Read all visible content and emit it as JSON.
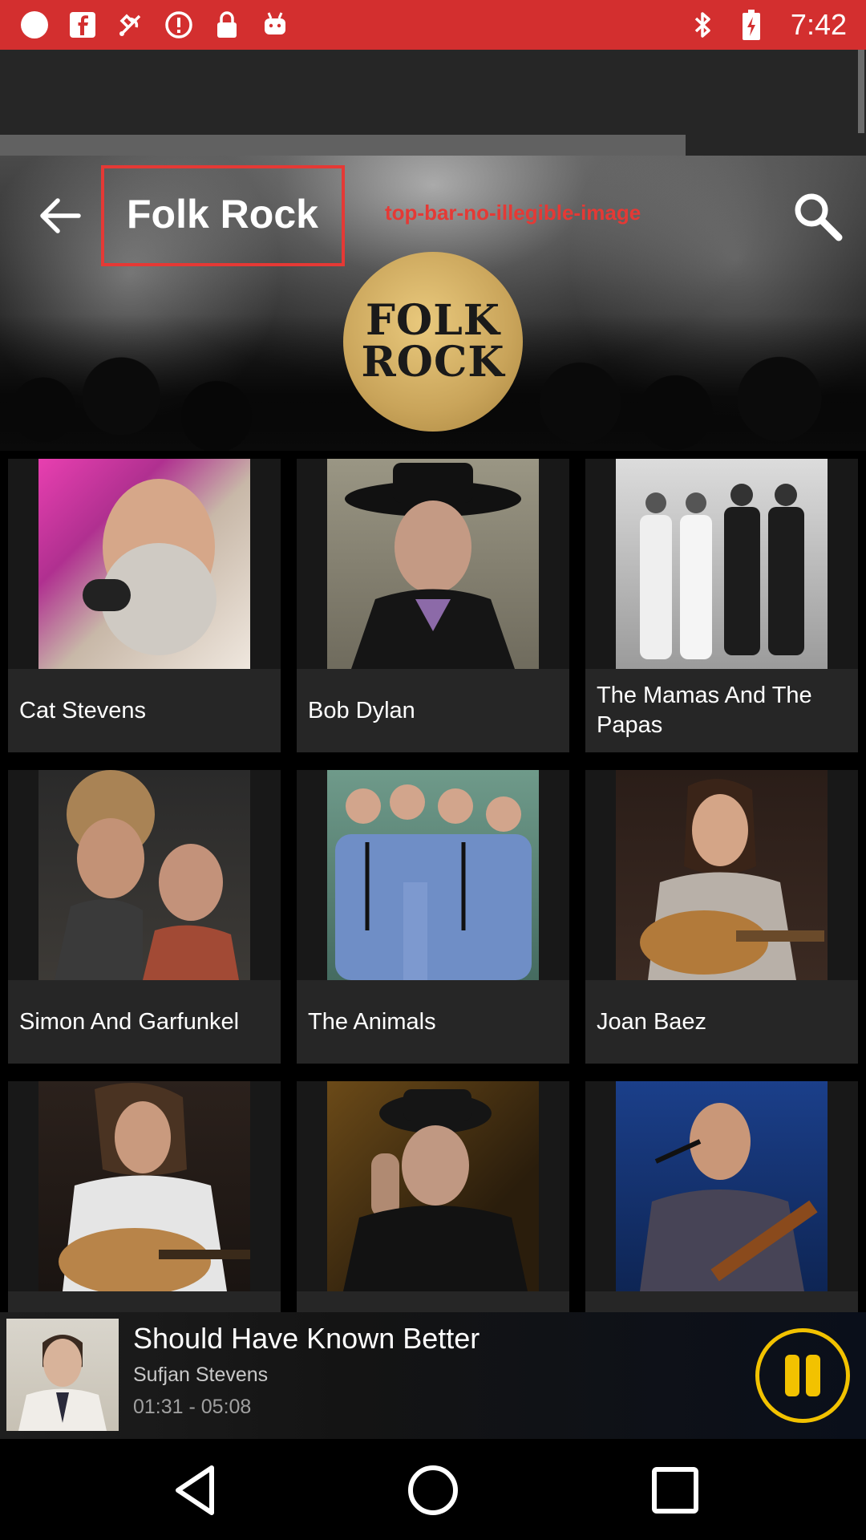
{
  "status_bar": {
    "time": "7:42",
    "background": "#d32f2f",
    "left_icons": [
      "circle-icon",
      "facebook-icon",
      "satellite-icon",
      "alert-icon",
      "lock-icon",
      "android-icon"
    ],
    "right_icons": [
      "bluetooth-icon",
      "battery-charging-icon"
    ]
  },
  "header": {
    "title": "Folk Rock",
    "overlay_label": "top-bar-no-illegible-image",
    "logo_lines": [
      "FOLK",
      "ROCK"
    ],
    "back_icon": "arrow-left-icon",
    "search_icon": "search-icon"
  },
  "artists": [
    {
      "name": "Cat Stevens"
    },
    {
      "name": "Bob Dylan"
    },
    {
      "name": "The Mamas And The Papas"
    },
    {
      "name": "Simon And Garfunkel"
    },
    {
      "name": "The Animals"
    },
    {
      "name": "Joan Baez"
    },
    {
      "name": ""
    },
    {
      "name": ""
    },
    {
      "name": ""
    }
  ],
  "player": {
    "title": "Should Have Known Better",
    "artist": "Sufjan Stevens",
    "time": "01:31 - 05:08",
    "accent": "#f2c200"
  },
  "navbar": {
    "icons": [
      "back-triangle-icon",
      "home-circle-icon",
      "recents-square-icon"
    ]
  }
}
